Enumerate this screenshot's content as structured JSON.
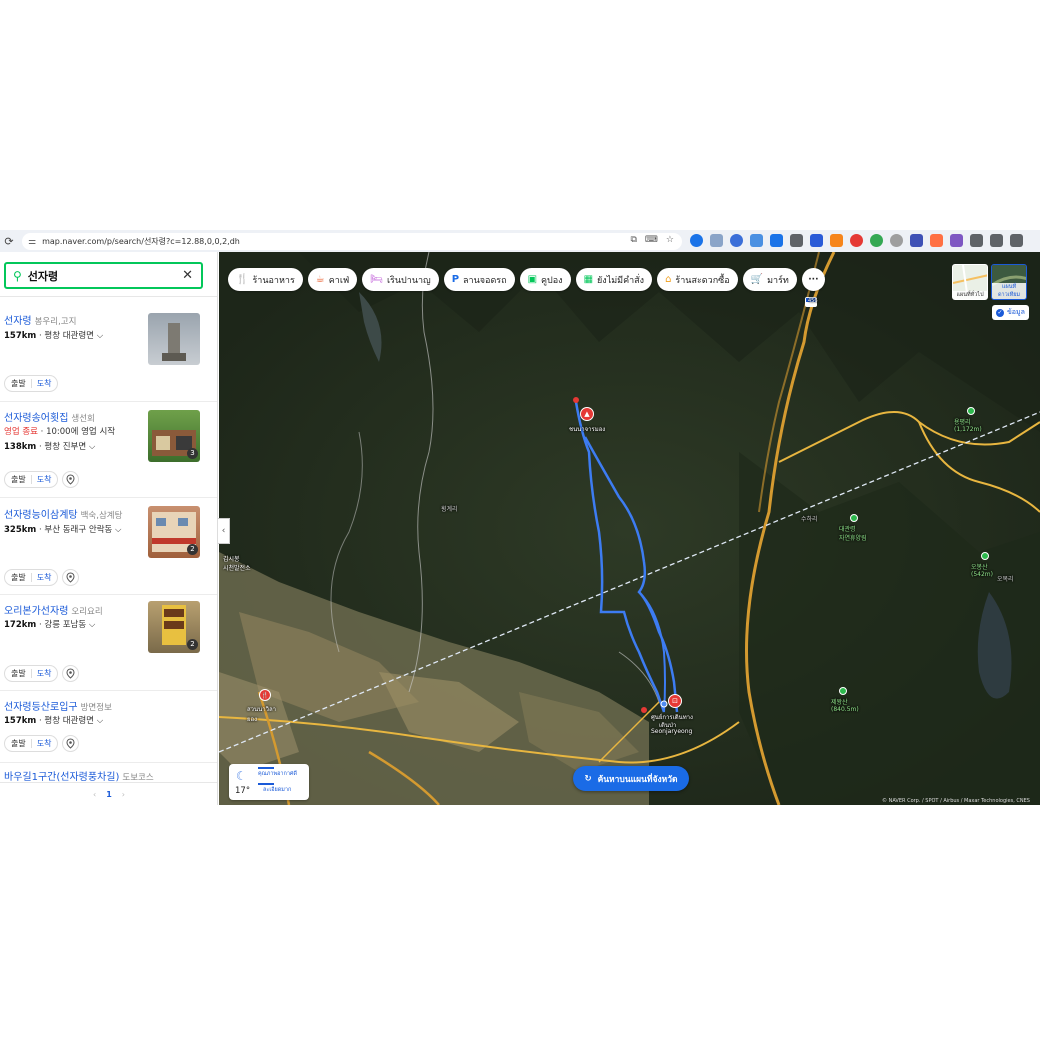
{
  "browser": {
    "url": "map.naver.com/p/search/선자령?c=12.88,0,0,2,dh"
  },
  "search": {
    "query": "선자령"
  },
  "results": [
    {
      "name": "선자령",
      "category": "봉우리,고지",
      "distance": "157km",
      "location": "평창 대관령면",
      "depart": "출발",
      "arrive": "도착",
      "status": "",
      "photo_count": ""
    },
    {
      "name": "선자령송어횟집",
      "category": "생선회",
      "status_label": "영업 종료",
      "status": " · 10:00에 영업 시작",
      "distance": "138km",
      "location": "평창 진부면",
      "depart": "출발",
      "arrive": "도착",
      "photo_count": "3"
    },
    {
      "name": "선자령능이삼계탕",
      "category": "백숙,삼계탕",
      "distance": "325km",
      "location": "부산 동래구 안락동",
      "depart": "출발",
      "arrive": "도착",
      "status": "",
      "photo_count": "2"
    },
    {
      "name": "오리본가선자령",
      "category": "오리요리",
      "distance": "172km",
      "location": "강릉 포남동",
      "depart": "출발",
      "arrive": "도착",
      "status": "",
      "photo_count": "2"
    },
    {
      "name": "선자령등산로입구",
      "category": "방면정보",
      "distance": "157km",
      "location": "평창 대관령면",
      "depart": "출발",
      "arrive": "도착",
      "status": "",
      "photo_count": ""
    },
    {
      "name": "바우길1구간(선자령풍차길)",
      "category": "도보코스",
      "distance": "",
      "location": "",
      "depart": "",
      "arrive": "",
      "status": "",
      "photo_count": ""
    }
  ],
  "pager": {
    "prev": "‹",
    "current": "1",
    "next": "›"
  },
  "categories": [
    {
      "label": "ร้านอาหาร",
      "icon": "utensils-icon",
      "color": "#f0a020"
    },
    {
      "label": "คาเฟ่",
      "icon": "cafe-icon",
      "color": "#e85a2a"
    },
    {
      "label": "เรินปานาญ",
      "icon": "bed-icon",
      "color": "#c05ad8"
    },
    {
      "label": "ลานจอดรถ",
      "icon": "parking-icon",
      "color": "#1a6be6"
    },
    {
      "label": "คูปอง",
      "icon": "coupon-icon",
      "color": "#03c75a"
    },
    {
      "label": "ยังไม่มีคำสั่ง",
      "icon": "calendar-icon",
      "color": "#03c75a"
    },
    {
      "label": "ร้านสะดวกซื้อ",
      "icon": "store-icon",
      "color": "#f0a020"
    },
    {
      "label": "มาร์ท",
      "icon": "cart-icon",
      "color": "#f0a020"
    }
  ],
  "more_label": "···",
  "layers": {
    "map_label": "แผนที่ทั่วไป",
    "satellite_label": "แผนที่ดาวเทียม",
    "info_label": "ข้อมูล",
    "info_icon": "✓"
  },
  "weather": {
    "temp": "17°",
    "air_quality": "คุณภาพอากาศดี",
    "air_detail": "ละเอียดมาก"
  },
  "search_area_button": "ค้นหาบนแผนที่จังหวัด",
  "copyright": "© NAVER Corp. / SPOT / Airbus / Maxar Technologies, CNES",
  "map_labels": {
    "peak": "ชนนาจารมอง",
    "start_point": "ศูนย์การเดินทาง",
    "start_sub": "เดินป่า",
    "start_en": "Seonjaryeong",
    "village_a": "횡계리",
    "village_b": "수하리",
    "village_c": "오목리",
    "place_left": "김시봉\n시천발전소",
    "restaurant": "สวนนาวิลา\nยอง",
    "park_a": "용평리\n(1,172m)",
    "park_b": "대관령\n자연휴양림",
    "park_c": "오봉산\n(542m)",
    "park_d": "제왕산\n(840.5m)",
    "route_label": "456"
  }
}
